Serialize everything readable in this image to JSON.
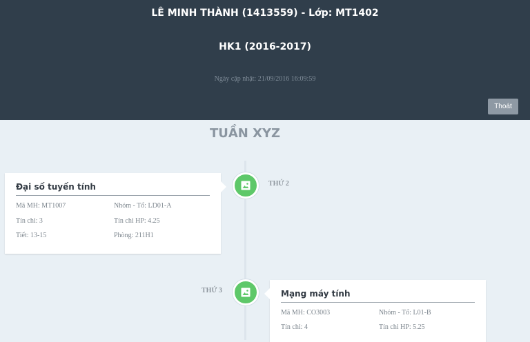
{
  "header": {
    "student_line": "LÊ MINH THÀNH (1413559) - Lớp: MT1402",
    "term": "HK1 (2016-2017)",
    "updated": "Ngày cập nhật: 21/09/2016 16:09:59",
    "logout_label": "Thoát"
  },
  "week_title": "TUẦN XYZ",
  "entries": [
    {
      "day": "THỨ 2",
      "course": "Đại số tuyến tính",
      "code": "Mã MH: MT1007",
      "group": "Nhóm - Tổ: LD01-A",
      "credits": "Tín chỉ: 3",
      "fee_credits": "Tín chỉ HP: 4.25",
      "periods": "Tiết: 13-15",
      "room": "Phòng: 211H1"
    },
    {
      "day": "THỨ 3",
      "course": "Mạng máy tính",
      "code": "Mã MH: CO3003",
      "group": "Nhóm - Tổ: L01-B",
      "credits": "Tín chỉ: 4",
      "fee_credits": "Tín chỉ HP: 5.25"
    }
  ],
  "icons": {
    "node": "image-icon"
  },
  "colors": {
    "header_bg": "#303e4b",
    "page_bg": "#e9f0f5",
    "node_green": "#5ec869",
    "logout_bg": "#8e99a4"
  }
}
